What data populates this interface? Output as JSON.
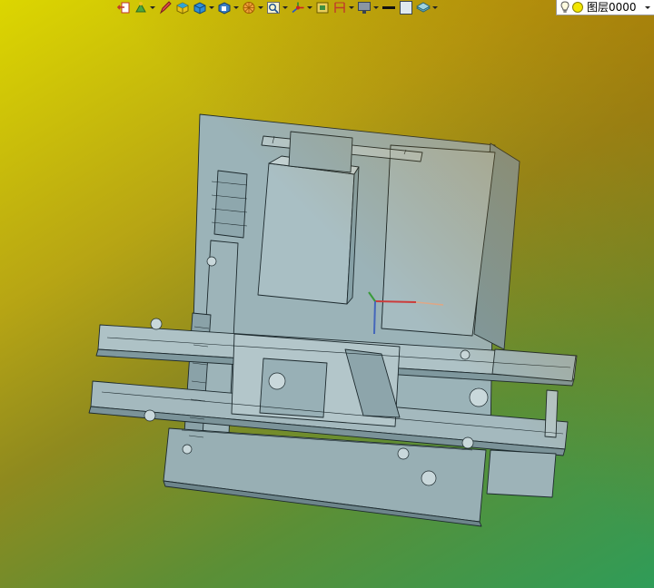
{
  "toolbar": {
    "buttons": [
      {
        "icon": "return-arrow-icon",
        "has_menu": false
      },
      {
        "icon": "tree-node-icon",
        "has_menu": true
      },
      {
        "icon": "pencil-sketch-icon",
        "has_menu": false
      },
      {
        "icon": "solid-box-yellow-icon",
        "has_menu": false
      },
      {
        "icon": "solid-box-blue-icon",
        "has_menu": true
      },
      {
        "icon": "view-cube-icon",
        "has_menu": true
      },
      {
        "icon": "render-sphere-icon",
        "has_menu": true
      },
      {
        "icon": "zoom-fit-icon",
        "has_menu": true
      },
      {
        "icon": "triad-axes-icon",
        "has_menu": true
      },
      {
        "icon": "section-view-icon",
        "has_menu": false
      },
      {
        "icon": "measure-icon",
        "has_menu": true
      },
      {
        "icon": "display-monitor-icon",
        "has_menu": true
      },
      {
        "icon": "line-weight-icon",
        "has_menu": false
      },
      {
        "icon": "color-swatch-icon",
        "has_menu": false
      },
      {
        "icon": "layer-stack-icon",
        "has_menu": true
      }
    ]
  },
  "layer": {
    "value": "图层0000",
    "bulb_icon": "lightbulb-icon",
    "color_icon": "layer-color-icon",
    "color": "#f2e600"
  },
  "scene": {
    "model_icon": "cad-assembly-model",
    "part_color": "#9bb3b8",
    "edge_color": "#1d2a2e"
  }
}
